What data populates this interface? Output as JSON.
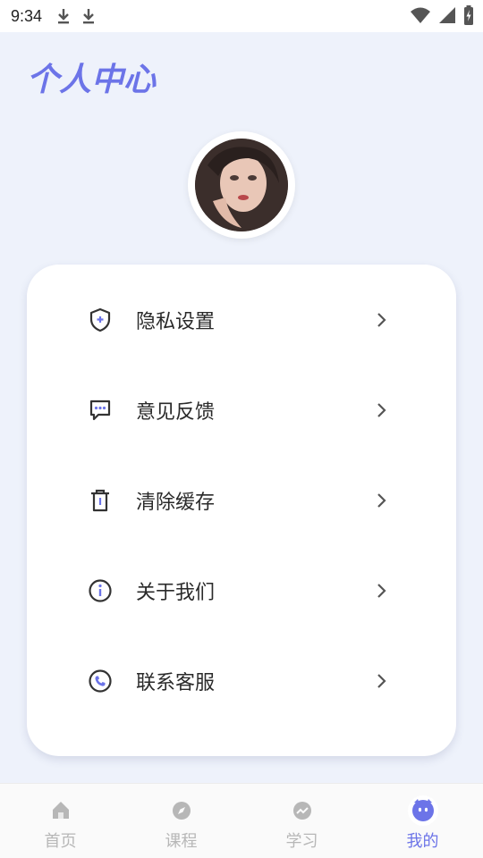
{
  "status_bar": {
    "time": "9:34",
    "icons": [
      "download-icon",
      "download-icon",
      "wifi-icon",
      "signal-icon",
      "battery-icon"
    ]
  },
  "page": {
    "title": "个人中心"
  },
  "profile": {
    "avatar_icon": "avatar"
  },
  "menu": {
    "items": [
      {
        "label": "隐私设置",
        "icon": "shield-icon"
      },
      {
        "label": "意见反馈",
        "icon": "chat-icon"
      },
      {
        "label": "清除缓存",
        "icon": "trash-icon"
      },
      {
        "label": "关于我们",
        "icon": "info-icon"
      },
      {
        "label": "联系客服",
        "icon": "phone-icon"
      }
    ]
  },
  "bottom_nav": {
    "items": [
      {
        "label": "首页",
        "icon": "home-icon",
        "active": false
      },
      {
        "label": "课程",
        "icon": "compass-icon",
        "active": false
      },
      {
        "label": "学习",
        "icon": "chart-icon",
        "active": false
      },
      {
        "label": "我的",
        "icon": "mascot-icon",
        "active": true
      }
    ]
  },
  "colors": {
    "accent": "#6c74e8",
    "background": "#eef2fb",
    "inactive": "#b7b7b7"
  }
}
